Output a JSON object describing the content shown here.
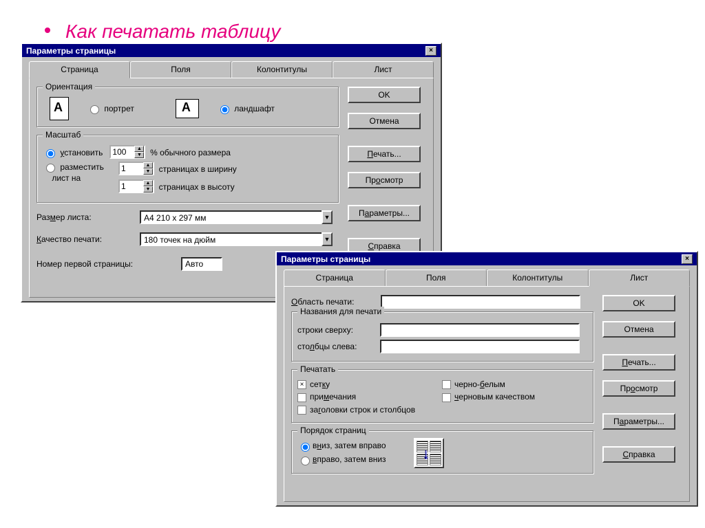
{
  "slide": {
    "title": "Как печатать таблицу"
  },
  "dialog1": {
    "title": "Параметры страницы",
    "tabs": [
      "Страница",
      "Поля",
      "Колонтитулы",
      "Лист"
    ],
    "active_tab_index": 0,
    "buttons": {
      "ok": "OK",
      "cancel": "Отмена",
      "print": "Печать...",
      "preview": "Просмотр",
      "options": "Параметры...",
      "help": "Справка"
    },
    "orientation": {
      "legend": "Ориентация",
      "portrait": "портрет",
      "landscape": "ландшафт",
      "selected": "landscape"
    },
    "scale": {
      "legend": "Масштаб",
      "set_label": "установить",
      "set_value": "100",
      "set_suffix": "% обычного размера",
      "fit_label": "разместить лист на",
      "fit_wide_value": "1",
      "fit_wide_suffix": "страницах в ширину",
      "fit_tall_value": "1",
      "fit_tall_suffix": "страницах в высоту",
      "selected": "set"
    },
    "paper_size_label": "Размер листа:",
    "paper_size_value": "A4 210 x 297 мм",
    "print_quality_label": "Качество печати:",
    "print_quality_value": "180 точек на дюйм",
    "first_page_label": "Номер первой страницы:",
    "first_page_value": "Авто"
  },
  "dialog2": {
    "title": "Параметры страницы",
    "tabs": [
      "Страница",
      "Поля",
      "Колонтитулы",
      "Лист"
    ],
    "active_tab_index": 3,
    "buttons": {
      "ok": "OK",
      "cancel": "Отмена",
      "print": "Печать...",
      "preview": "Просмотр",
      "options": "Параметры...",
      "help": "Справка"
    },
    "print_area_label": "Область печати:",
    "print_area_value": "",
    "titles": {
      "legend": "Названия для печати",
      "rows_label": "строки сверху:",
      "rows_value": "",
      "cols_label": "столбцы слева:",
      "cols_value": ""
    },
    "print_opts": {
      "legend": "Печатать",
      "gridlines": "сетку",
      "gridlines_checked": true,
      "notes": "примечания",
      "notes_checked": false,
      "bw": "черно-белым",
      "bw_checked": false,
      "draft": "черновым качеством",
      "draft_checked": false,
      "headings": "заголовки строк и столбцов",
      "headings_checked": false
    },
    "page_order": {
      "legend": "Порядок страниц",
      "down": "вниз, затем вправо",
      "over": "вправо, затем вниз",
      "selected": "down"
    }
  }
}
